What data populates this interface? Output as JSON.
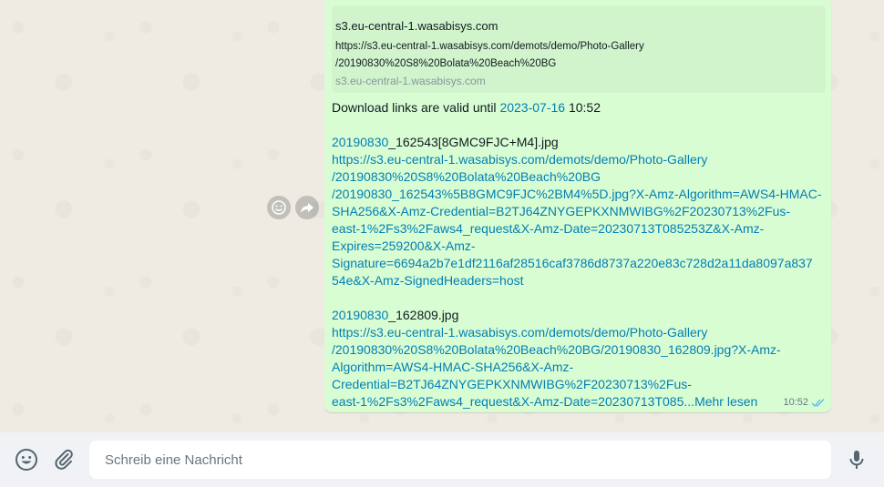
{
  "message": {
    "preview": {
      "title": "s3.eu-central-1.wasabisys.com",
      "url_line1": "https://s3.eu-central-1.wasabisys.com/demots/demo/Photo-Gallery",
      "url_line2": "/20190830%20S8%20Bolata%20Beach%20BG",
      "domain": "s3.eu-central-1.wasabisys.com"
    },
    "valid_prefix": "Download links are valid until ",
    "valid_date": "2023-07-16",
    "valid_time": " 10:52",
    "file1": {
      "date_link": "20190830",
      "name_rest": "_162543[8GMC9FJC+M4].jpg",
      "url_lines": [
        "https://s3.eu-central-1.wasabisys.com/demots/demo/Photo-Gallery",
        "/20190830%20S8%20Bolata%20Beach%20BG",
        "/20190830_162543%5B8GMC9FJC%2BM4%5D.jpg?X-Amz-Algorithm=AWS4-HMAC-",
        "SHA256&X-Amz-Credential=B2TJ64ZNYGEPKXNMWIBG%2F20230713%2Fus-",
        "east-1%2Fs3%2Faws4_request&X-Amz-Date=20230713T085253Z&X-Amz-",
        "Expires=259200&X-Amz-",
        "Signature=6694a2b7e1df2116af28516caf3786d8737a220e83c728d2a11da8097a837",
        "54e&X-Amz-SignedHeaders=host"
      ]
    },
    "file2": {
      "date_link": "20190830",
      "name_rest": "_162809.jpg",
      "url_lines": [
        "https://s3.eu-central-1.wasabisys.com/demots/demo/Photo-Gallery",
        "/20190830%20S8%20Bolata%20Beach%20BG/20190830_162809.jpg?X-Amz-",
        "Algorithm=AWS4-HMAC-SHA256&X-Amz-",
        "Credential=B2TJ64ZNYGEPKXNMWIBG%2F20230713%2Fus-",
        "east-1%2Fs3%2Faws4_request&X-Amz-Date=20230713T085..."
      ]
    },
    "read_more": "Mehr lesen",
    "time": "10:52"
  },
  "composer": {
    "placeholder": "Schreib eine Nachricht"
  },
  "icons": {
    "emoji": "smiley-icon",
    "attach": "paperclip-icon",
    "mic": "microphone-icon",
    "react": "reaction-emoji-icon",
    "forward": "forward-icon"
  },
  "colors": {
    "bubble": "#d9fdd3",
    "preview": "#d1f4cc",
    "link": "#027eb5",
    "ticks": "#53bdeb"
  }
}
